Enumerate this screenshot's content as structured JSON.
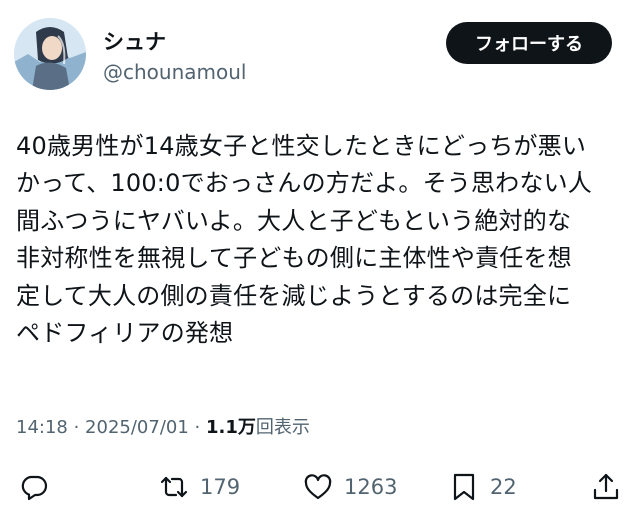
{
  "author": {
    "display_name": "シュナ",
    "handle": "@chounamoul"
  },
  "follow_button_label": "フォローする",
  "tweet": {
    "lines": [
      "40歳男性が14歳女子と性交したときにどっちが悪い",
      "かって、100:0でおっさんの方だよ。そう思わない人",
      "間ふつうにヤバいよ。大人と子どもという絶対的な",
      "非対称性を無視して子どもの側に主体性や責任を想",
      "定して大人の側の責任を減じようとするのは完全に",
      "ペドフィリアの発想"
    ]
  },
  "meta": {
    "time": "14:18",
    "separator": " · ",
    "date": "2025/07/01",
    "views_count": "1.1万",
    "views_label": "回表示"
  },
  "actions": {
    "reply": {
      "icon": "reply-icon",
      "count": ""
    },
    "retweet": {
      "icon": "retweet-icon",
      "count": "179"
    },
    "like": {
      "icon": "heart-icon",
      "count": "1263"
    },
    "bookmark": {
      "icon": "bookmark-icon",
      "count": "22"
    },
    "share": {
      "icon": "share-icon",
      "count": ""
    }
  },
  "colors": {
    "text": "#0f1419",
    "secondary_text": "#536471",
    "follow_button_bg": "#0f1419",
    "follow_button_text": "#ffffff",
    "background": "#ffffff"
  }
}
